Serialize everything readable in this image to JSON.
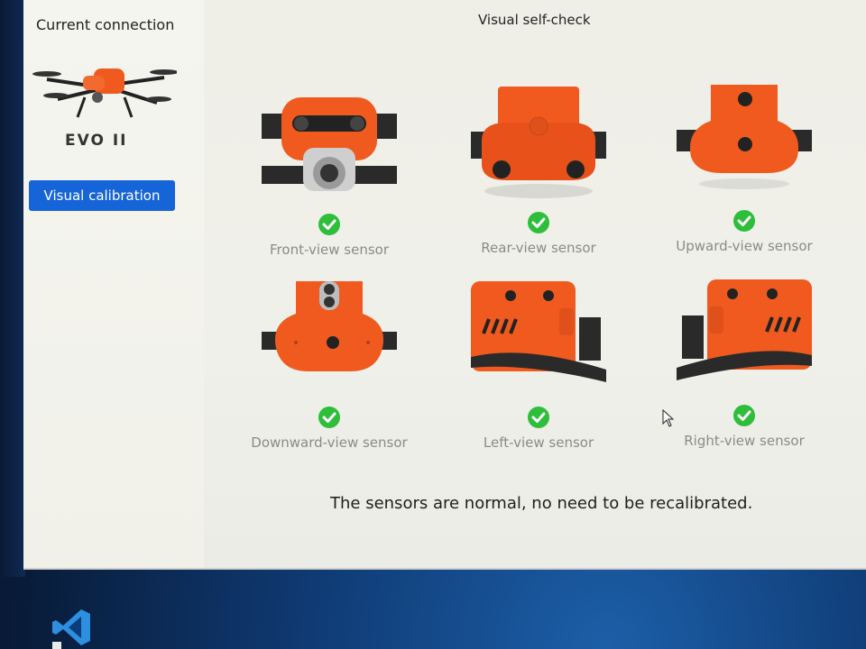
{
  "sidebar": {
    "title": "Current connection",
    "model_name": "EVO II",
    "calibration_button": "Visual calibration"
  },
  "main": {
    "title": "Visual self-check",
    "sensors": [
      {
        "label": "Front-view sensor",
        "status": "ok"
      },
      {
        "label": "Rear-view sensor",
        "status": "ok"
      },
      {
        "label": "Upward-view sensor",
        "status": "ok"
      },
      {
        "label": "Downward-view sensor",
        "status": "ok"
      },
      {
        "label": "Left-view sensor",
        "status": "ok"
      },
      {
        "label": "Right-view sensor",
        "status": "ok"
      }
    ],
    "status_message": "The sensors are normal, no need to be recalibrated."
  },
  "colors": {
    "accent": "#1565d8",
    "drone_orange": "#f05a1e",
    "check_green": "#2fbd3c"
  },
  "icons": [
    "drone-thumbnail-icon",
    "check-icon",
    "mouse-cursor-icon",
    "vscode-taskbar-icon"
  ]
}
